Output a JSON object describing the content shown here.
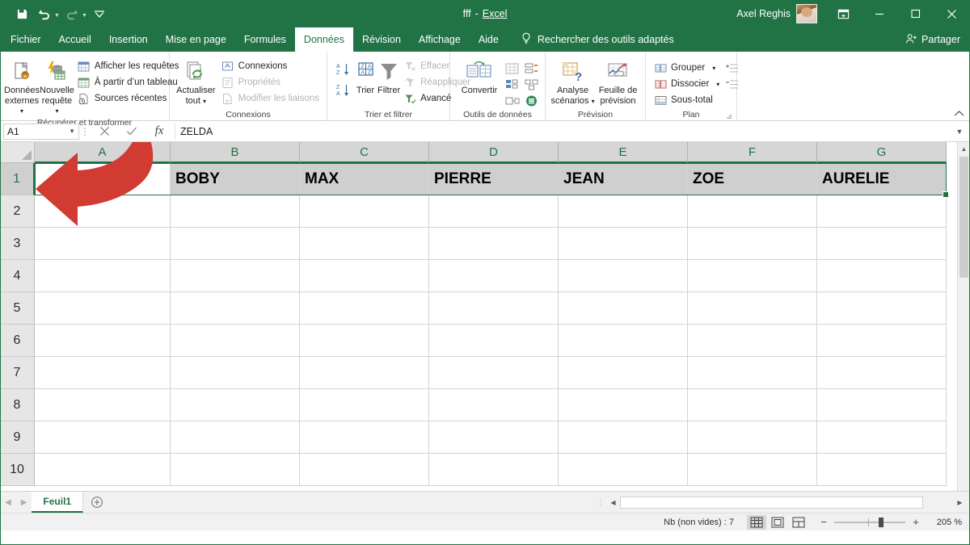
{
  "titlebar": {
    "quick_access": [
      {
        "name": "save",
        "icon": "save-icon",
        "label": "Enregistrer",
        "disabled": false
      },
      {
        "name": "undo",
        "icon": "undo-icon",
        "label": "Annuler",
        "disabled": false
      },
      {
        "name": "redo",
        "icon": "redo-icon",
        "label": "Rétablir",
        "disabled": true
      },
      {
        "name": "customize",
        "icon": "chevron-down-icon",
        "label": "Personnaliser la barre d'outils Accès rapide",
        "disabled": false
      }
    ],
    "document_name": "fff",
    "separator": "-",
    "app_name": "Excel",
    "user_name": "Axel Reghis",
    "window_buttons": {
      "ribbon_display": "Options d'affichage du ruban",
      "minimize": "Réduire",
      "restore": "Agrandir",
      "close": "Fermer"
    }
  },
  "tabs": [
    {
      "label": "Fichier",
      "active": false
    },
    {
      "label": "Accueil",
      "active": false
    },
    {
      "label": "Insertion",
      "active": false
    },
    {
      "label": "Mise en page",
      "active": false
    },
    {
      "label": "Formules",
      "active": false
    },
    {
      "label": "Données",
      "active": true
    },
    {
      "label": "Révision",
      "active": false
    },
    {
      "label": "Affichage",
      "active": false
    },
    {
      "label": "Aide",
      "active": false
    }
  ],
  "tell_me": {
    "icon": "lightbulb-icon",
    "placeholder": "Rechercher des outils adaptés"
  },
  "share": {
    "icon": "share-person-icon",
    "label": "Partager"
  },
  "ribbon": {
    "collapse_label": "Réduire le ruban",
    "groups": [
      {
        "name": "recuperer-et-transformer",
        "label": "Récupérer et transformer",
        "big_buttons": [
          {
            "name": "donnees-externes",
            "icon": "external-data-icon",
            "line1": "Données",
            "line2": "externes",
            "has_caret": true
          }
        ],
        "big_buttons2": [
          {
            "name": "nouvelle-requete",
            "icon": "new-query-icon",
            "line1": "Nouvelle",
            "line2": "requête",
            "has_caret": true
          }
        ],
        "small_buttons": [
          {
            "name": "afficher-les-requetes",
            "icon": "show-queries-icon",
            "label": "Afficher les requêtes",
            "disabled": false
          },
          {
            "name": "a-partir-d-un-tableau",
            "icon": "from-table-icon",
            "label": "À partir d’un tableau",
            "disabled": false
          },
          {
            "name": "sources-recentes",
            "icon": "recent-sources-icon",
            "label": "Sources récentes",
            "disabled": false
          }
        ]
      },
      {
        "name": "connexions",
        "label": "Connexions",
        "big_buttons": [
          {
            "name": "actualiser-tout",
            "icon": "refresh-all-icon",
            "line1": "Actualiser",
            "line2": "tout",
            "has_caret": true
          }
        ],
        "small_buttons": [
          {
            "name": "connexions",
            "icon": "connections-icon",
            "label": "Connexions",
            "disabled": false
          },
          {
            "name": "proprietes",
            "icon": "properties-icon",
            "label": "Propriétés",
            "disabled": true
          },
          {
            "name": "modifier-les-liaisons",
            "icon": "edit-links-icon",
            "label": "Modifier les liaisons",
            "disabled": true
          }
        ]
      },
      {
        "name": "trier-et-filtrer",
        "label": "Trier et filtrer",
        "icon_buttons": [
          {
            "name": "trier-a-z",
            "icon": "sort-az-icon",
            "label": "Trier de A à Z"
          },
          {
            "name": "trier-z-a",
            "icon": "sort-za-icon",
            "label": "Trier de Z à A"
          }
        ],
        "big_buttons": [
          {
            "name": "trier",
            "icon": "sort-icon",
            "line1": "Trier",
            "line2": "",
            "has_caret": false
          },
          {
            "name": "filtrer",
            "icon": "filter-icon",
            "line1": "Filtrer",
            "line2": "",
            "has_caret": false
          }
        ],
        "small_buttons": [
          {
            "name": "effacer",
            "icon": "clear-filter-icon",
            "label": "Effacer",
            "disabled": true
          },
          {
            "name": "reappliquer",
            "icon": "reapply-icon",
            "label": "Réappliquer",
            "disabled": true
          },
          {
            "name": "avance",
            "icon": "advanced-filter-icon",
            "label": "Avancé",
            "disabled": false
          }
        ]
      },
      {
        "name": "outils-de-donnees",
        "label": "Outils de données",
        "big_buttons": [
          {
            "name": "convertir",
            "icon": "text-to-columns-icon",
            "line1": "Convertir",
            "line2": "",
            "has_caret": false
          }
        ],
        "mini_icons": [
          {
            "name": "remplissage-instantane",
            "icon": "flash-fill-icon"
          },
          {
            "name": "supprimer-les-doublons",
            "icon": "remove-duplicates-icon"
          },
          {
            "name": "validation-des-donnees",
            "icon": "data-validation-icon"
          },
          {
            "name": "consolider",
            "icon": "consolidate-icon"
          },
          {
            "name": "relations",
            "icon": "relationships-icon"
          },
          {
            "name": "gerer-le-modele-de-donnees",
            "icon": "manage-data-model-icon"
          }
        ]
      },
      {
        "name": "prevision",
        "label": "Prévision",
        "big_buttons": [
          {
            "name": "analyse-scenarios",
            "icon": "what-if-icon",
            "line1": "Analyse",
            "line2": "scénarios",
            "has_caret": true
          },
          {
            "name": "feuille-de-prevision",
            "icon": "forecast-sheet-icon",
            "line1": "Feuille de",
            "line2": "prévision",
            "has_caret": false
          }
        ]
      },
      {
        "name": "plan",
        "label": "Plan",
        "dialog_launcher": "Paramètres du plan",
        "small_buttons": [
          {
            "name": "grouper",
            "icon": "group-icon",
            "label": "Grouper",
            "disabled": false,
            "caret": true
          },
          {
            "name": "dissocier",
            "icon": "ungroup-icon",
            "label": "Dissocier",
            "disabled": false,
            "caret": true
          },
          {
            "name": "sous-total",
            "icon": "subtotal-icon",
            "label": "Sous-total",
            "disabled": false,
            "caret": false
          }
        ],
        "side_icons": [
          {
            "name": "afficher-les-details",
            "icon": "show-detail-icon"
          },
          {
            "name": "masquer-les-details",
            "icon": "hide-detail-icon"
          }
        ]
      }
    ]
  },
  "formula_bar": {
    "name_box_value": "A1",
    "name_box_caret": "chevron-down-icon",
    "cancel_icon": "cancel-x-icon",
    "cancel_label": "Annuler",
    "enter_icon": "check-icon",
    "enter_label": "Entrer",
    "fx_label": "fx",
    "insert_function_label": "Insérer une fonction",
    "value": "ZELDA",
    "expand_icon": "chevron-down-icon",
    "expand_label": "Développer la barre de formule"
  },
  "grid": {
    "select_all_label": "Sélectionner tout",
    "column_headers": [
      "A",
      "B",
      "C",
      "D",
      "E",
      "F",
      "G"
    ],
    "row_headers": [
      "1",
      "2",
      "3",
      "4",
      "5",
      "6",
      "7",
      "8",
      "9",
      "10"
    ],
    "selected_row": "1",
    "selection_range": "A1:G1",
    "rows": [
      {
        "header": "1",
        "header_rowspan": true,
        "cells": [
          "",
          "BOBY",
          "MAX",
          "PIERRE",
          "JEAN",
          "ZOE",
          "AURELIE"
        ],
        "styled": true
      },
      {
        "header": "2",
        "cells": [
          "",
          "",
          "",
          "",
          "",
          "",
          ""
        ],
        "styled": false
      },
      {
        "header": "3",
        "cells": [
          "",
          "",
          "",
          "",
          "",
          "",
          ""
        ],
        "styled": false
      },
      {
        "header": "4",
        "cells": [
          "",
          "",
          "",
          "",
          "",
          "",
          ""
        ],
        "styled": false
      },
      {
        "header": "5",
        "cells": [
          "",
          "",
          "",
          "",
          "",
          "",
          ""
        ],
        "styled": false
      },
      {
        "header": "6",
        "cells": [
          "",
          "",
          "",
          "",
          "",
          "",
          ""
        ],
        "styled": false
      },
      {
        "header": "7",
        "cells": [
          "",
          "",
          "",
          "",
          "",
          "",
          ""
        ],
        "styled": false
      },
      {
        "header": "8",
        "cells": [
          "",
          "",
          "",
          "",
          "",
          "",
          ""
        ],
        "styled": false
      },
      {
        "header": "9",
        "cells": [
          "",
          "",
          "",
          "",
          "",
          "",
          ""
        ],
        "styled": false
      },
      {
        "header": "10",
        "cells": [
          "",
          "",
          "",
          "",
          "",
          "",
          ""
        ],
        "styled": false
      }
    ]
  },
  "annotation": {
    "name": "red-curved-arrow",
    "color": "#d13b32",
    "points_to": "A1",
    "description": "Flèche rouge incurvée pointant vers la cellule A1"
  },
  "sheet_bar": {
    "nav_prev_icon": "chevron-left-icon",
    "nav_next_icon": "chevron-right-icon",
    "sheets": [
      {
        "label": "Feuil1",
        "active": true
      }
    ],
    "add_sheet_icon": "plus-circle-icon",
    "add_sheet_label": "Nouvelle feuille"
  },
  "status_bar": {
    "count_label": "Nb (non vides) : 7",
    "views": [
      {
        "name": "normal",
        "icon": "normal-view-icon",
        "label": "Normal",
        "active": true
      },
      {
        "name": "mise-en-page",
        "icon": "page-layout-icon",
        "label": "Mise en page",
        "active": false
      },
      {
        "name": "apercu-sauts-de-page",
        "icon": "page-break-preview-icon",
        "label": "Aperçu des sauts de page",
        "active": false
      }
    ],
    "zoom_out_icon": "minus-icon",
    "zoom_in_icon": "plus-icon",
    "zoom_value": "205 %"
  },
  "colors": {
    "excel_green": "#217346",
    "accent_red": "#d13b32",
    "header_fill": "#cfcfcf"
  }
}
